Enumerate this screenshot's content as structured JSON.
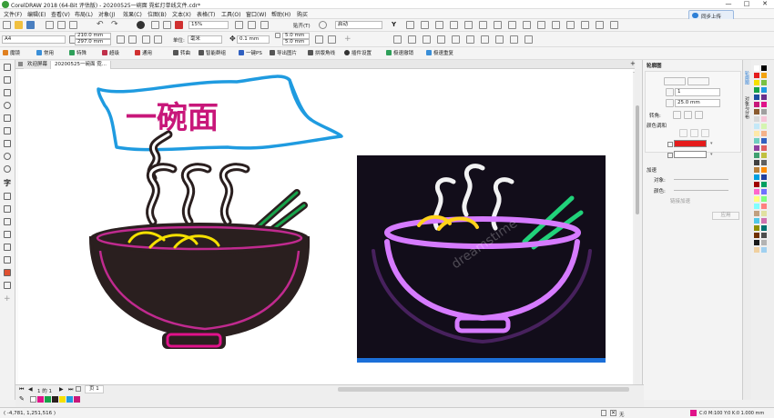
{
  "titlebar": {
    "title": "CorelDRAW 2018 (64-Bit 评估版) - 20200525一碗面 霓虹灯单线文件.cdr*",
    "minimize": "—",
    "maximize": "□",
    "close": "✕"
  },
  "menubar": {
    "items": [
      "文件(F)",
      "编辑(E)",
      "查看(V)",
      "布局(L)",
      "对象(J)",
      "效果(C)",
      "位图(B)",
      "文本(X)",
      "表格(T)",
      "工具(O)",
      "窗口(W)",
      "帮助(H)",
      "购买"
    ],
    "upload_label": "同步上传"
  },
  "toolbar": {
    "zoom": "15%",
    "snap": "贴齐(T)",
    "launch": "启动"
  },
  "propbar": {
    "page_size": "A4",
    "width": "210.0 mm",
    "height": "297.0 mm",
    "unit_label": "单位:",
    "unit": "毫米",
    "nudge": "0.1 mm",
    "dup_x": "5.0 mm",
    "dup_y": "5.0 mm"
  },
  "pluginbar": {
    "items": [
      "魔镜",
      "常用",
      "特殊",
      "超级",
      "通用",
      "转曲",
      "智能群组",
      "一键PS",
      "导出图片",
      "拼版角线",
      "插件设置",
      "极速撤销",
      "极速重复"
    ]
  },
  "tabs": {
    "welcome": "欢迎屏幕",
    "doc": "20200525一碗面 霓..."
  },
  "design": {
    "banner_text": "一碗面",
    "colors": {
      "banner": "#1f9be0",
      "text": "#c8177a",
      "bowl": "#2a1f1f",
      "rim": "#c02a8f",
      "noodle": "#f5e000",
      "chopstick": "#17a34a",
      "base": "#e0128a"
    },
    "watermark": "dreamstime"
  },
  "rightpanel": {
    "title": "轮廓图",
    "steps": "1",
    "offset": "25.0 mm",
    "corners_label": "转角:",
    "color_blend_label": "颜色调和",
    "accel_label": "加速",
    "object_label": "对象:",
    "color_label": "颜色:",
    "link_label": "链接加速",
    "apply_label": "应用"
  },
  "dockertabs": {
    "tab1": "轮廓图",
    "tab2": "对象与分布"
  },
  "bottombar": {
    "page_nav": "1 的 1",
    "page_tab": "页 1"
  },
  "statusbar": {
    "coords": "( -4,781, 1,251,516 )",
    "fill_info": "C:0 M:100 Y:0 K:0 1.000 mm",
    "fill_none": "无"
  }
}
